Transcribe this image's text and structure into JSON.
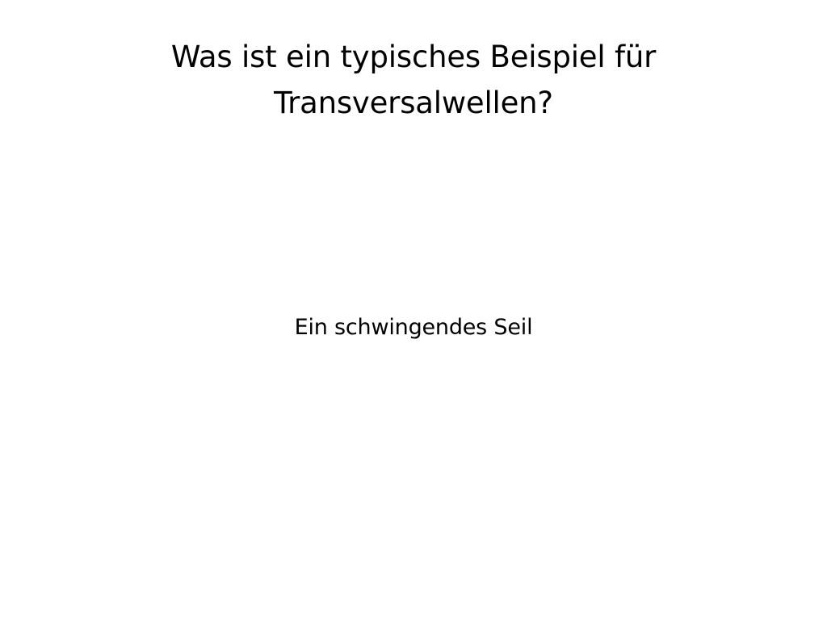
{
  "card": {
    "question_line_1": "Was ist ein typisches Beispiel für",
    "question_line_2": "Transversalwellen?",
    "answer": "Ein schwingendes Seil"
  }
}
